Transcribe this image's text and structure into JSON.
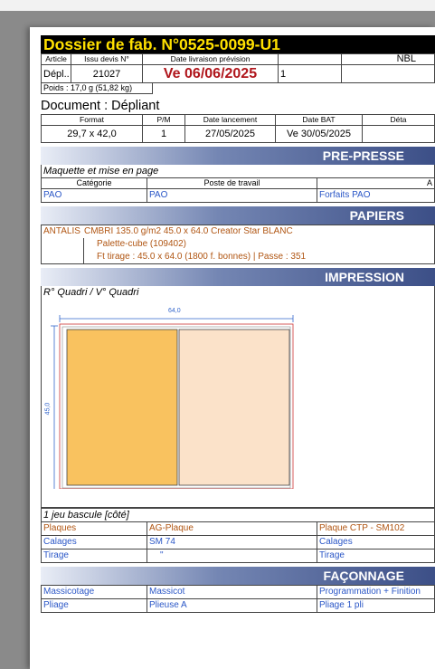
{
  "title": "Dossier de fab. N°0525-0099-U1",
  "header": {
    "col_article": "Article",
    "col_devis": "Issu devis N°",
    "col_livraison": "Date livraison prévision",
    "col_empty": "",
    "col_nbl": "NBL",
    "article": "Dépl..",
    "devis": "21027",
    "livraison": "Ve 06/06/2025",
    "empty_val": "",
    "nbl_val": "1"
  },
  "poids": "Poids : 17,0 g (51,82 kg)",
  "document": {
    "title": "Document : Dépliant",
    "headers": [
      "Format",
      "P/M",
      "Date lancement",
      "Date BAT",
      "Déta"
    ],
    "values": [
      "29,7 x 42,0",
      "1",
      "27/05/2025",
      "Ve 30/05/2025",
      ""
    ]
  },
  "prepresse": {
    "label": "PRE-PRESSE",
    "subtitle": "Maquette et mise en page",
    "headers": [
      "Catégorie",
      "Poste de travail",
      "A"
    ],
    "values": [
      "PAO",
      "PAO",
      "Forfaits PAO"
    ]
  },
  "papiers": {
    "label": "PAPIERS",
    "supplier": "ANTALIS",
    "line1": "CMBRI 135.0 g/m2 45.0 x 64.0 Creator Star BLANC",
    "line2": "Palette-cube (109402)",
    "line3": "Ft tirage : 45.0 x 64.0 (1800 f. bonnes) | Passe : 351"
  },
  "impression": {
    "label": "IMPRESSION",
    "subtitle": "R° Quadri / V° Quadri",
    "dim_width": "64,0",
    "dim_height": "45,0",
    "jeu": "1 jeu bascule [côté]",
    "rows": [
      [
        "Plaques",
        "AG-Plaque",
        "Plaque CTP - SM102"
      ],
      [
        "Calages",
        "SM 74",
        "Calages"
      ],
      [
        "Tirage",
        "\"",
        "Tirage"
      ]
    ]
  },
  "faconnage": {
    "label": "FAÇONNAGE",
    "rows": [
      [
        "Massicotage",
        "Massicot",
        "Programmation + Finition"
      ],
      [
        "Pliage",
        "Plieuse A",
        "Pliage 1 pli"
      ]
    ]
  },
  "colors": {
    "title_bg": "#000000",
    "title_fg": "#ffe000",
    "date": "#b0161c",
    "blue_text": "#2b57c7",
    "orange_text": "#b05512",
    "section": "#3c4f87",
    "sheet_a": "#f9c25f",
    "sheet_b": "#fbe2c9"
  }
}
